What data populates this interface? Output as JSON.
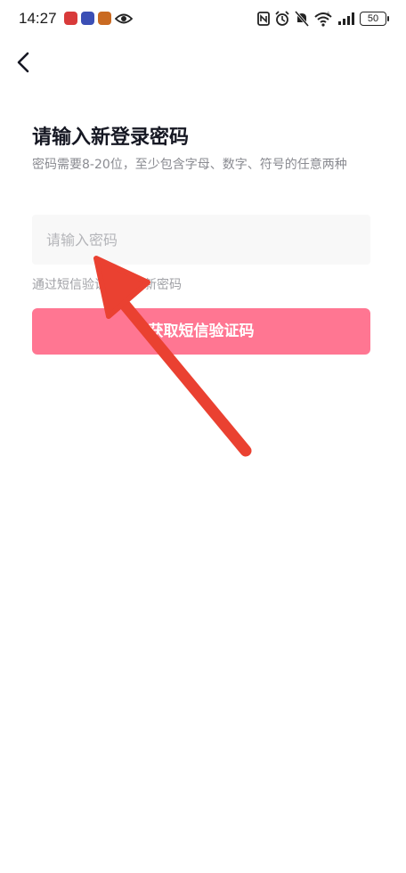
{
  "status_bar": {
    "time": "14:27",
    "battery": "50",
    "icons": [
      "app-notification-red",
      "app-notification-blue",
      "app-notification-orange",
      "eye-icon",
      "nfc-icon",
      "alarm-icon",
      "mute-icon",
      "wifi-icon",
      "signal-icon"
    ]
  },
  "header": {
    "back_icon": "chevron-left-icon"
  },
  "main": {
    "title": "请输入新登录密码",
    "description": "密码需要8-20位，至少包含字母、数字、符号的任意两种",
    "password_placeholder": "请输入密码",
    "hint": "通过短信验证后使用新密码",
    "sms_button_label": "获取短信验证码"
  },
  "colors": {
    "accent": "#ff7692",
    "annotation_arrow": "#ea4131"
  },
  "annotation": {
    "type": "arrow",
    "points_to": "password-input"
  }
}
